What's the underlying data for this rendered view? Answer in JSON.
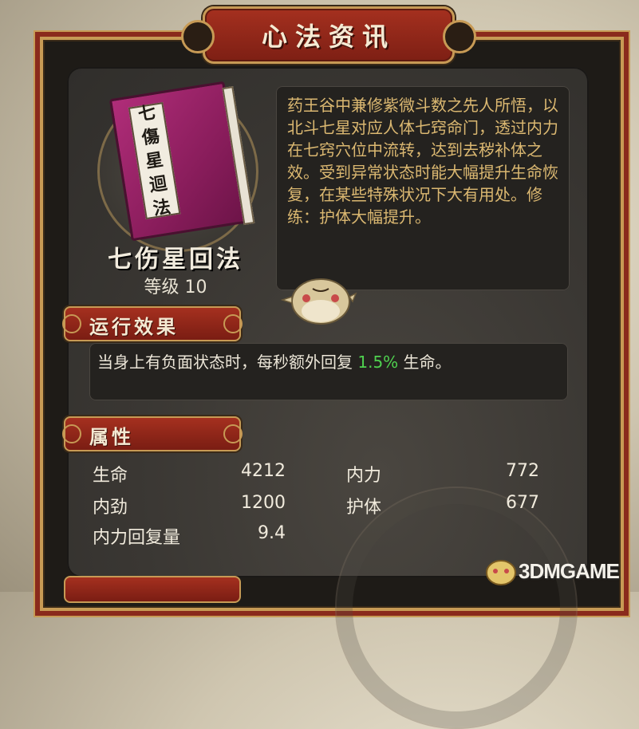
{
  "window": {
    "title": "心法资讯"
  },
  "book": {
    "name": "七伤星回法",
    "cover_label_chars": [
      "七",
      "傷",
      "星",
      "迴",
      "法"
    ],
    "level_label": "等级",
    "level_value": "10",
    "level_text": "等级 10"
  },
  "description": "药王谷中兼修紫微斗数之先人所悟，以北斗七星对应人体七窍命门，透过内力在七窍穴位中流转，达到去秽补体之效。受到异常状态时能大幅提升生命恢复，在某些特殊状况下大有用处。修练：护体大幅提升。",
  "sections": {
    "effect": {
      "title": "运行效果",
      "text_before": "当身上有负面状态时，每秒额外回复 ",
      "highlight": "1.5%",
      "text_after": " 生命。",
      "highlight_color": "#4fd14f"
    },
    "attributes": {
      "title": "属性",
      "stats": [
        {
          "label": "生命",
          "value": "4212"
        },
        {
          "label": "内力",
          "value": "772"
        },
        {
          "label": "内劲",
          "value": "1200"
        },
        {
          "label": "护体",
          "value": "677"
        },
        {
          "label": "内力回复量",
          "value": "9.4"
        }
      ]
    }
  },
  "watermark": {
    "text": "3DMGAME"
  },
  "colors": {
    "frame_red": "#8a2a1c",
    "gold_trim": "#c79a55",
    "description_text": "#dbb871",
    "panel_bg": "#3a3733"
  }
}
